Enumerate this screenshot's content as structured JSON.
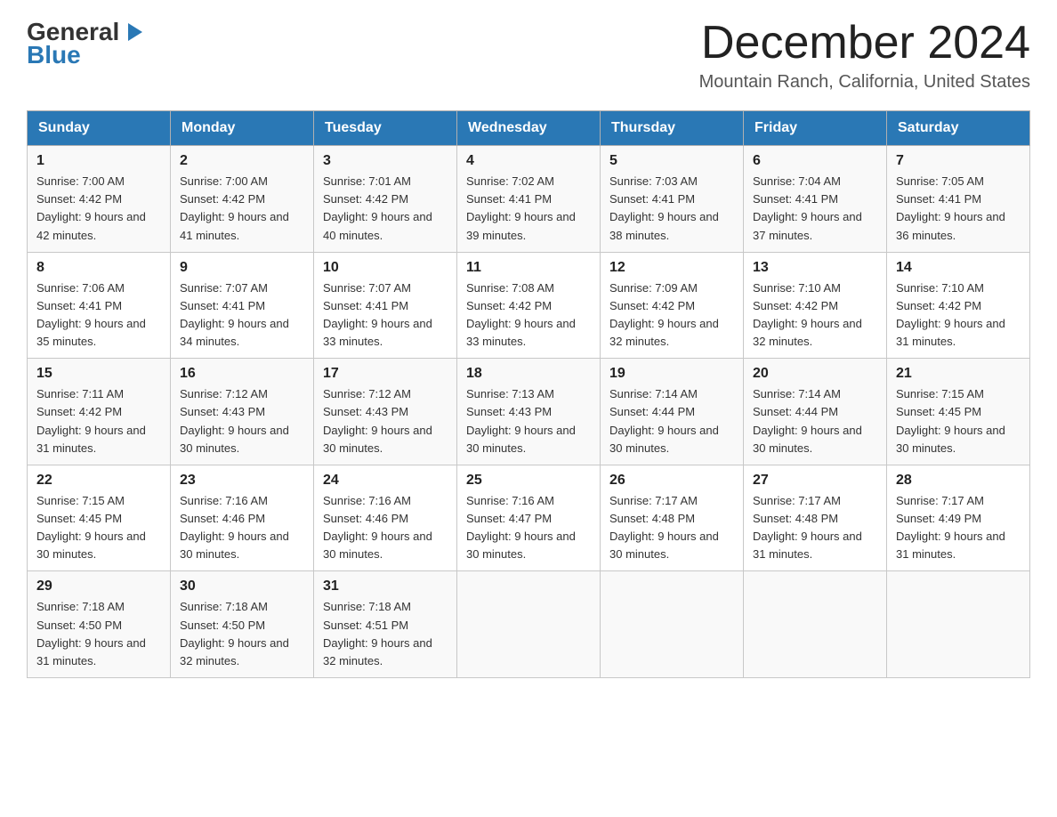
{
  "header": {
    "logo": {
      "general": "General",
      "blue": "Blue",
      "triangle": "▶"
    },
    "title": "December 2024",
    "location": "Mountain Ranch, California, United States"
  },
  "days_of_week": [
    "Sunday",
    "Monday",
    "Tuesday",
    "Wednesday",
    "Thursday",
    "Friday",
    "Saturday"
  ],
  "weeks": [
    [
      {
        "day": "1",
        "sunrise": "7:00 AM",
        "sunset": "4:42 PM",
        "daylight": "9 hours and 42 minutes."
      },
      {
        "day": "2",
        "sunrise": "7:00 AM",
        "sunset": "4:42 PM",
        "daylight": "9 hours and 41 minutes."
      },
      {
        "day": "3",
        "sunrise": "7:01 AM",
        "sunset": "4:42 PM",
        "daylight": "9 hours and 40 minutes."
      },
      {
        "day": "4",
        "sunrise": "7:02 AM",
        "sunset": "4:41 PM",
        "daylight": "9 hours and 39 minutes."
      },
      {
        "day": "5",
        "sunrise": "7:03 AM",
        "sunset": "4:41 PM",
        "daylight": "9 hours and 38 minutes."
      },
      {
        "day": "6",
        "sunrise": "7:04 AM",
        "sunset": "4:41 PM",
        "daylight": "9 hours and 37 minutes."
      },
      {
        "day": "7",
        "sunrise": "7:05 AM",
        "sunset": "4:41 PM",
        "daylight": "9 hours and 36 minutes."
      }
    ],
    [
      {
        "day": "8",
        "sunrise": "7:06 AM",
        "sunset": "4:41 PM",
        "daylight": "9 hours and 35 minutes."
      },
      {
        "day": "9",
        "sunrise": "7:07 AM",
        "sunset": "4:41 PM",
        "daylight": "9 hours and 34 minutes."
      },
      {
        "day": "10",
        "sunrise": "7:07 AM",
        "sunset": "4:41 PM",
        "daylight": "9 hours and 33 minutes."
      },
      {
        "day": "11",
        "sunrise": "7:08 AM",
        "sunset": "4:42 PM",
        "daylight": "9 hours and 33 minutes."
      },
      {
        "day": "12",
        "sunrise": "7:09 AM",
        "sunset": "4:42 PM",
        "daylight": "9 hours and 32 minutes."
      },
      {
        "day": "13",
        "sunrise": "7:10 AM",
        "sunset": "4:42 PM",
        "daylight": "9 hours and 32 minutes."
      },
      {
        "day": "14",
        "sunrise": "7:10 AM",
        "sunset": "4:42 PM",
        "daylight": "9 hours and 31 minutes."
      }
    ],
    [
      {
        "day": "15",
        "sunrise": "7:11 AM",
        "sunset": "4:42 PM",
        "daylight": "9 hours and 31 minutes."
      },
      {
        "day": "16",
        "sunrise": "7:12 AM",
        "sunset": "4:43 PM",
        "daylight": "9 hours and 30 minutes."
      },
      {
        "day": "17",
        "sunrise": "7:12 AM",
        "sunset": "4:43 PM",
        "daylight": "9 hours and 30 minutes."
      },
      {
        "day": "18",
        "sunrise": "7:13 AM",
        "sunset": "4:43 PM",
        "daylight": "9 hours and 30 minutes."
      },
      {
        "day": "19",
        "sunrise": "7:14 AM",
        "sunset": "4:44 PM",
        "daylight": "9 hours and 30 minutes."
      },
      {
        "day": "20",
        "sunrise": "7:14 AM",
        "sunset": "4:44 PM",
        "daylight": "9 hours and 30 minutes."
      },
      {
        "day": "21",
        "sunrise": "7:15 AM",
        "sunset": "4:45 PM",
        "daylight": "9 hours and 30 minutes."
      }
    ],
    [
      {
        "day": "22",
        "sunrise": "7:15 AM",
        "sunset": "4:45 PM",
        "daylight": "9 hours and 30 minutes."
      },
      {
        "day": "23",
        "sunrise": "7:16 AM",
        "sunset": "4:46 PM",
        "daylight": "9 hours and 30 minutes."
      },
      {
        "day": "24",
        "sunrise": "7:16 AM",
        "sunset": "4:46 PM",
        "daylight": "9 hours and 30 minutes."
      },
      {
        "day": "25",
        "sunrise": "7:16 AM",
        "sunset": "4:47 PM",
        "daylight": "9 hours and 30 minutes."
      },
      {
        "day": "26",
        "sunrise": "7:17 AM",
        "sunset": "4:48 PM",
        "daylight": "9 hours and 30 minutes."
      },
      {
        "day": "27",
        "sunrise": "7:17 AM",
        "sunset": "4:48 PM",
        "daylight": "9 hours and 31 minutes."
      },
      {
        "day": "28",
        "sunrise": "7:17 AM",
        "sunset": "4:49 PM",
        "daylight": "9 hours and 31 minutes."
      }
    ],
    [
      {
        "day": "29",
        "sunrise": "7:18 AM",
        "sunset": "4:50 PM",
        "daylight": "9 hours and 31 minutes."
      },
      {
        "day": "30",
        "sunrise": "7:18 AM",
        "sunset": "4:50 PM",
        "daylight": "9 hours and 32 minutes."
      },
      {
        "day": "31",
        "sunrise": "7:18 AM",
        "sunset": "4:51 PM",
        "daylight": "9 hours and 32 minutes."
      },
      null,
      null,
      null,
      null
    ]
  ],
  "labels": {
    "sunrise": "Sunrise:",
    "sunset": "Sunset:",
    "daylight": "Daylight:"
  }
}
